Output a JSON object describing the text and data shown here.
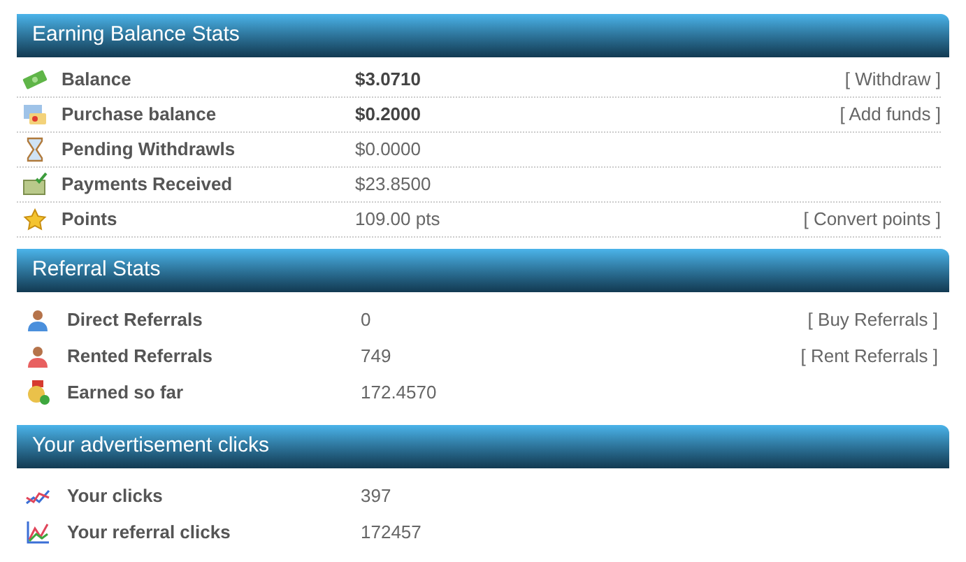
{
  "sections": [
    {
      "title": "Earning Balance Stats",
      "ruled": true,
      "rows": [
        {
          "label": "Balance",
          "value": "$3.0710",
          "bold": true,
          "link": "[ Withdraw ]"
        },
        {
          "label": "Purchase balance",
          "value": "$0.2000",
          "bold": true,
          "link": "[ Add funds ]"
        },
        {
          "label": "Pending Withdrawls",
          "value": "$0.0000",
          "bold": false
        },
        {
          "label": "Payments Received",
          "value": "$23.8500",
          "bold": false
        },
        {
          "label": "Points",
          "value": "109.00 pts",
          "bold": false,
          "link": "[ Convert points ]"
        }
      ]
    },
    {
      "title": "Referral Stats",
      "ruled": false,
      "rows": [
        {
          "label": "Direct Referrals",
          "value": "0",
          "bold": false,
          "link": "[ Buy Referrals ]"
        },
        {
          "label": "Rented Referrals",
          "value": "749",
          "bold": false,
          "link": "[ Rent Referrals ]"
        },
        {
          "label": "Earned so far",
          "value": "172.4570",
          "bold": false
        }
      ]
    },
    {
      "title": "Your advertisement clicks",
      "ruled": false,
      "rows": [
        {
          "label": "Your clicks",
          "value": "397",
          "bold": false
        },
        {
          "label": "Your referral clicks",
          "value": "172457",
          "bold": false
        }
      ]
    }
  ]
}
